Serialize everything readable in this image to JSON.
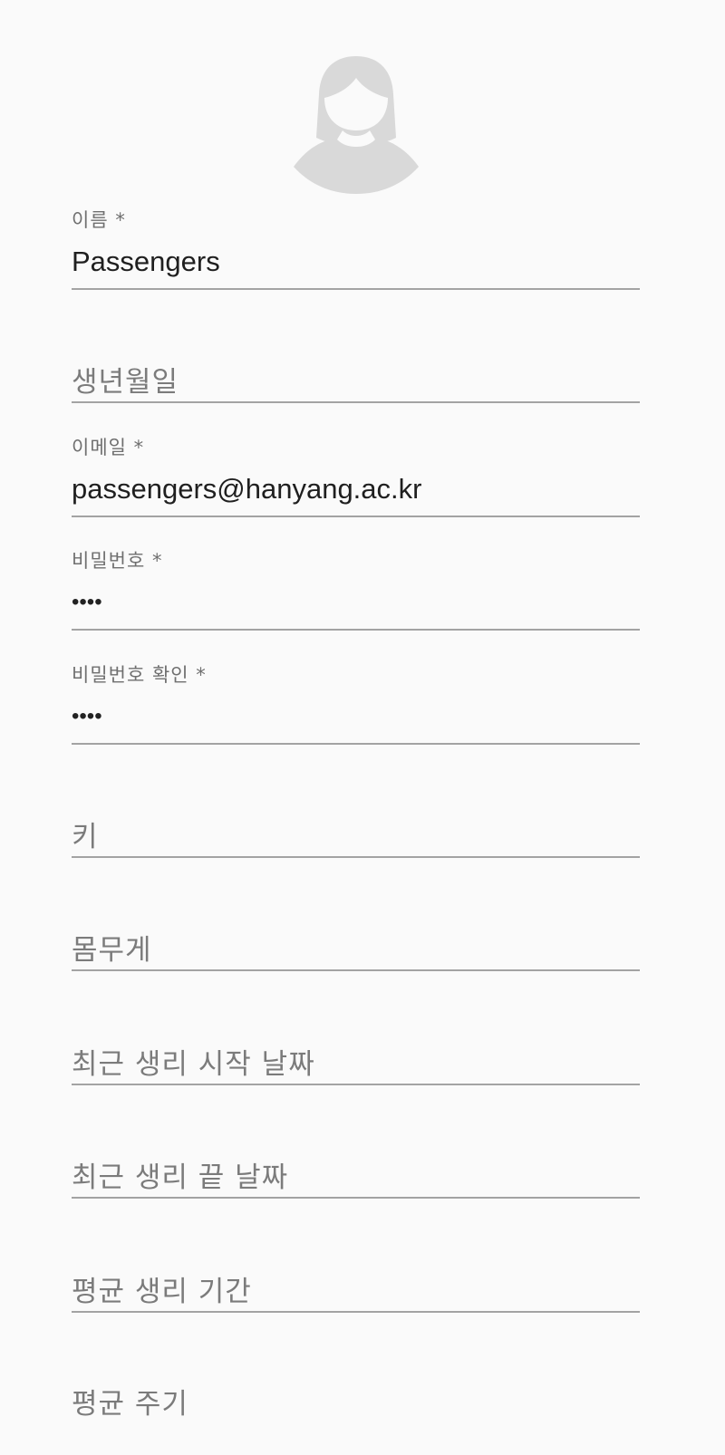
{
  "form": {
    "name_label": "이름 *",
    "name_value": "Passengers",
    "birthdate_placeholder": "생년월일",
    "email_label": "이메일 *",
    "email_value": "passengers@hanyang.ac.kr",
    "password_label": "비밀번호 *",
    "password_value": "••••",
    "password_confirm_label": "비밀번호 확인 *",
    "password_confirm_value": "••••",
    "height_placeholder": "키",
    "weight_placeholder": "몸무게",
    "last_period_start_placeholder": "최근 생리 시작 날짜",
    "last_period_end_placeholder": "최근 생리 끝 날짜",
    "avg_period_length_placeholder": "평균 생리 기간",
    "avg_cycle_placeholder": "평균 주기"
  },
  "avatar": {
    "icon": "female-avatar-icon",
    "color": "#d9d9d9"
  },
  "colors": {
    "background": "#fafafa",
    "underline": "#a3a3a3",
    "label": "#6f6f6f",
    "value": "#1f1f1f",
    "placeholder": "#7b7b7b"
  }
}
